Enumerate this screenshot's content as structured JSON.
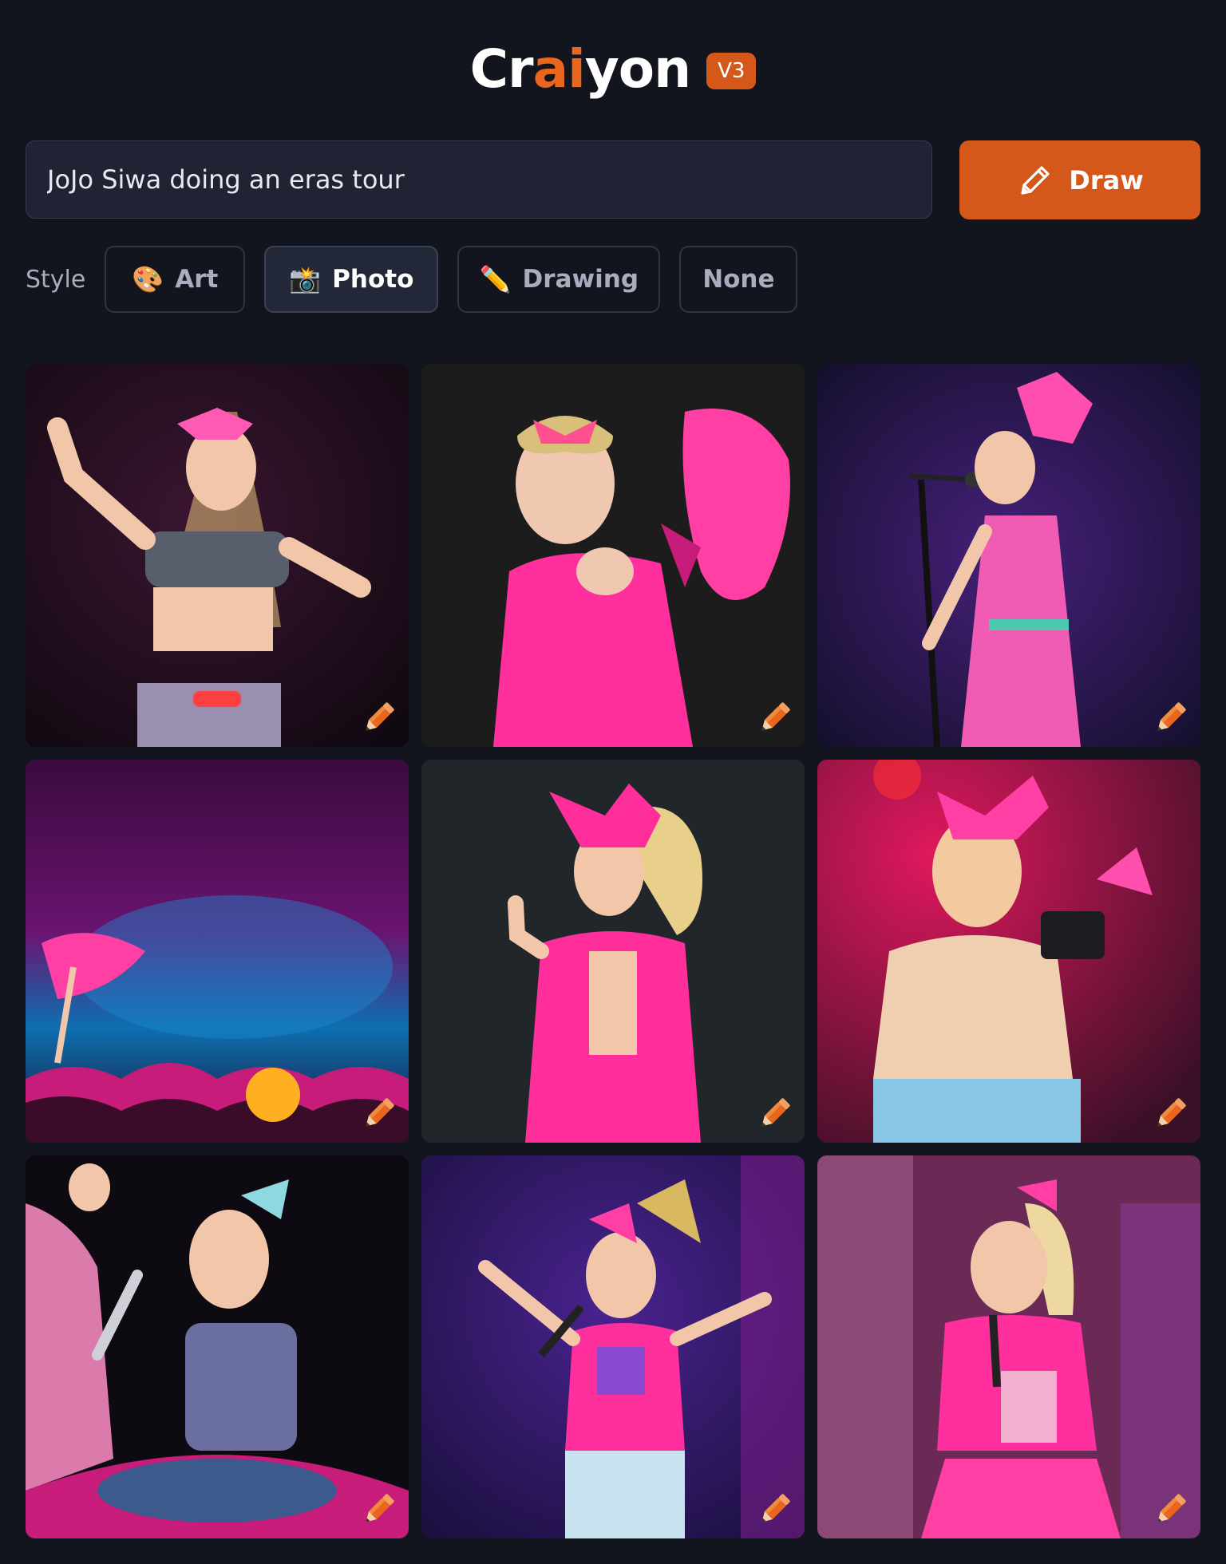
{
  "app": {
    "logo_parts": [
      "Cr",
      "ai",
      "yon"
    ],
    "version": "V3",
    "accent_color": "#d4581a"
  },
  "prompt": {
    "value": "JoJo Siwa doing an eras tour"
  },
  "draw_button": {
    "label": "Draw",
    "icon": "pencil-icon"
  },
  "style": {
    "label": "Style",
    "options": [
      {
        "label": "Art",
        "icon": "palette-icon",
        "emoji": "🎨",
        "selected": false
      },
      {
        "label": "Photo",
        "icon": "camera-flash-icon",
        "emoji": "📸",
        "selected": true
      },
      {
        "label": "Drawing",
        "icon": "pencil-icon",
        "emoji": "✏️",
        "selected": false
      },
      {
        "label": "None",
        "icon": "",
        "emoji": "",
        "selected": false
      }
    ]
  },
  "results": {
    "count": 9,
    "edit_icon": "pencil-edit-icon",
    "images": [
      {
        "description_colors": [
          "#1a0f1c",
          "#3a1530",
          "#e24a9a"
        ]
      },
      {
        "description_colors": [
          "#151515",
          "#262626",
          "#ff3fa4"
        ]
      },
      {
        "description_colors": [
          "#1d1440",
          "#46207a",
          "#f05bb4"
        ]
      },
      {
        "description_colors": [
          "#3a0a3e",
          "#0e6fb0",
          "#ff3fa4"
        ]
      },
      {
        "description_colors": [
          "#1b1f22",
          "#2b3136",
          "#ff2e9b"
        ]
      },
      {
        "description_colors": [
          "#b0124e",
          "#3a1026",
          "#f3c9a0"
        ]
      },
      {
        "description_colors": [
          "#0e0a12",
          "#5c1a50",
          "#3c5a8c"
        ]
      },
      {
        "description_colors": [
          "#1d1650",
          "#7a1e8c",
          "#ff3fa4"
        ]
      },
      {
        "description_colors": [
          "#6b2a56",
          "#a0608a",
          "#ff3fa4"
        ]
      }
    ]
  }
}
